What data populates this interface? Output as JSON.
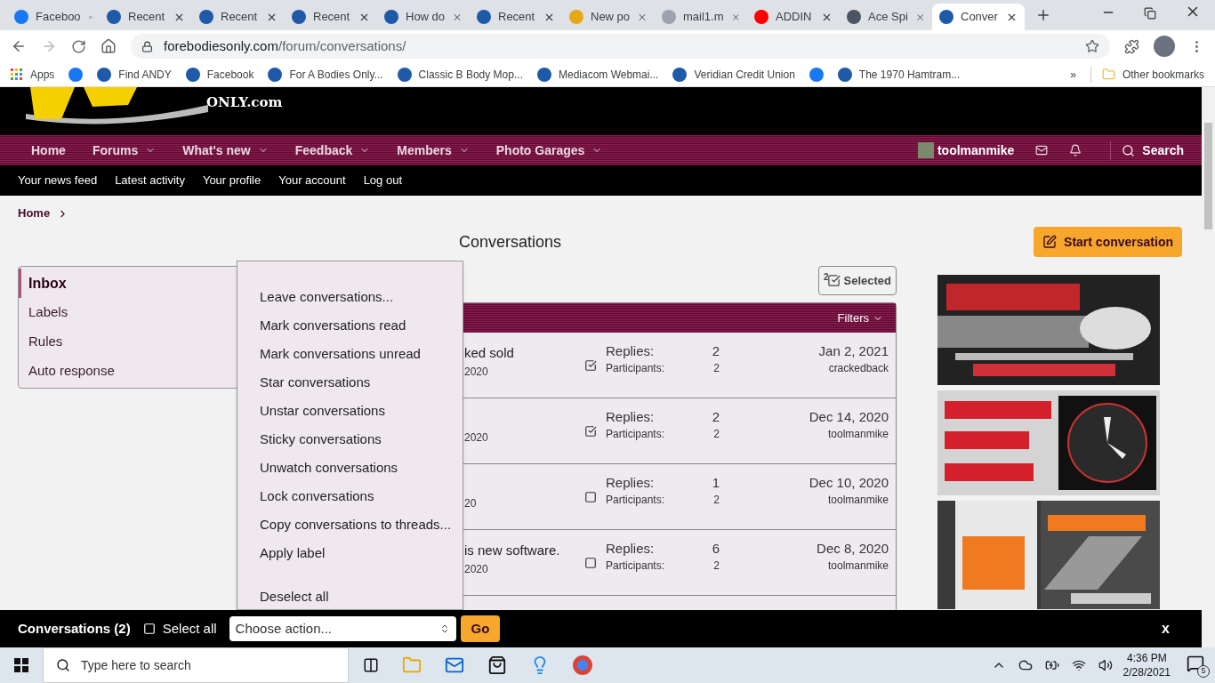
{
  "browser": {
    "tabs": [
      {
        "title": "Faceboo",
        "selected": false
      },
      {
        "title": "Recent",
        "selected": false
      },
      {
        "title": "Recent",
        "selected": false
      },
      {
        "title": "Recent",
        "selected": false
      },
      {
        "title": "How do",
        "selected": false
      },
      {
        "title": "Recent",
        "selected": false
      },
      {
        "title": "New po",
        "selected": false
      },
      {
        "title": "mail1.m",
        "selected": false
      },
      {
        "title": "ADDIN",
        "selected": false
      },
      {
        "title": "Ace Spi",
        "selected": false
      },
      {
        "title": "Conver",
        "selected": true
      }
    ],
    "url": {
      "domain": "forebodiesonly.com",
      "path": "/forum/conversations/"
    },
    "bookmarks": [
      {
        "kind": "apps",
        "label": "Apps"
      },
      {
        "kind": "icon"
      },
      {
        "kind": "link",
        "label": "Find ANDY"
      },
      {
        "kind": "link",
        "label": "Facebook"
      },
      {
        "kind": "link",
        "label": "For A Bodies Only..."
      },
      {
        "kind": "link",
        "label": "Classic B Body Mop..."
      },
      {
        "kind": "link",
        "label": "Mediacom Webmai..."
      },
      {
        "kind": "link",
        "label": "Veridian Credit Union"
      },
      {
        "kind": "icon"
      },
      {
        "kind": "link",
        "label": "The 1970 Hamtram..."
      }
    ],
    "bookmarks_overflow": "»",
    "other_bookmarks": "Other bookmarks"
  },
  "site": {
    "logo_text": "ONLY.com",
    "nav": [
      {
        "label": "Home",
        "dropdown": false
      },
      {
        "label": "Forums",
        "dropdown": true
      },
      {
        "label": "What's new",
        "dropdown": true
      },
      {
        "label": "Feedback",
        "dropdown": true
      },
      {
        "label": "Members",
        "dropdown": true
      },
      {
        "label": "Photo Garages",
        "dropdown": true
      }
    ],
    "user": "toolmanmike",
    "search": "Search",
    "subnav": [
      "Your news feed",
      "Latest activity",
      "Your profile",
      "Your account",
      "Log out"
    ],
    "breadcrumb": "Home",
    "page_title": "Conversations",
    "start_button": "Start conversation",
    "sidebar": [
      {
        "label": "Inbox",
        "selected": true
      },
      {
        "label": "Labels",
        "selected": false
      },
      {
        "label": "Rules",
        "selected": false
      },
      {
        "label": "Auto response",
        "selected": false
      }
    ],
    "selected_button": {
      "count": "2",
      "label": "Selected"
    },
    "filters": "Filters",
    "rows": [
      {
        "title": "ked sold",
        "started": "2020",
        "checked": true,
        "replies_label": "Replies:",
        "replies": "2",
        "participants_label": "Participants:",
        "participants": "2",
        "date": "Jan 2, 2021",
        "user": "crackedback"
      },
      {
        "started": "2020",
        "checked": true,
        "replies_label": "Replies:",
        "replies": "2",
        "participants_label": "Participants:",
        "participants": "2",
        "date": "Dec 14, 2020",
        "user": "toolmanmike"
      },
      {
        "started": "20",
        "checked": false,
        "replies_label": "Replies:",
        "replies": "1",
        "participants_label": "Participants:",
        "participants": "2",
        "date": "Dec 10, 2020",
        "user": "toolmanmike"
      },
      {
        "title": "is new software.",
        "started": "2020",
        "checked": false,
        "replies_label": "Replies:",
        "replies": "6",
        "participants_label": "Participants:",
        "participants": "2",
        "date": "Dec 8, 2020",
        "user": "toolmanmike"
      }
    ],
    "menu": {
      "items": [
        "Leave conversations...",
        "Mark conversations read",
        "Mark conversations unread",
        "Star conversations",
        "Unstar conversations",
        "Sticky conversations",
        "Unwatch conversations",
        "Lock conversations",
        "Copy conversations to threads...",
        "Apply label"
      ],
      "footer_item": "Deselect all"
    },
    "bottom_bar": {
      "title": "Conversations (2)",
      "select_all": {
        "label": "Select all",
        "checked": false
      },
      "action": "Choose action...",
      "go": "Go",
      "close": "x"
    }
  },
  "taskbar": {
    "search_placeholder": "Type here to search",
    "time": "4:36 PM",
    "date": "2/28/2021",
    "notifications": "5"
  }
}
